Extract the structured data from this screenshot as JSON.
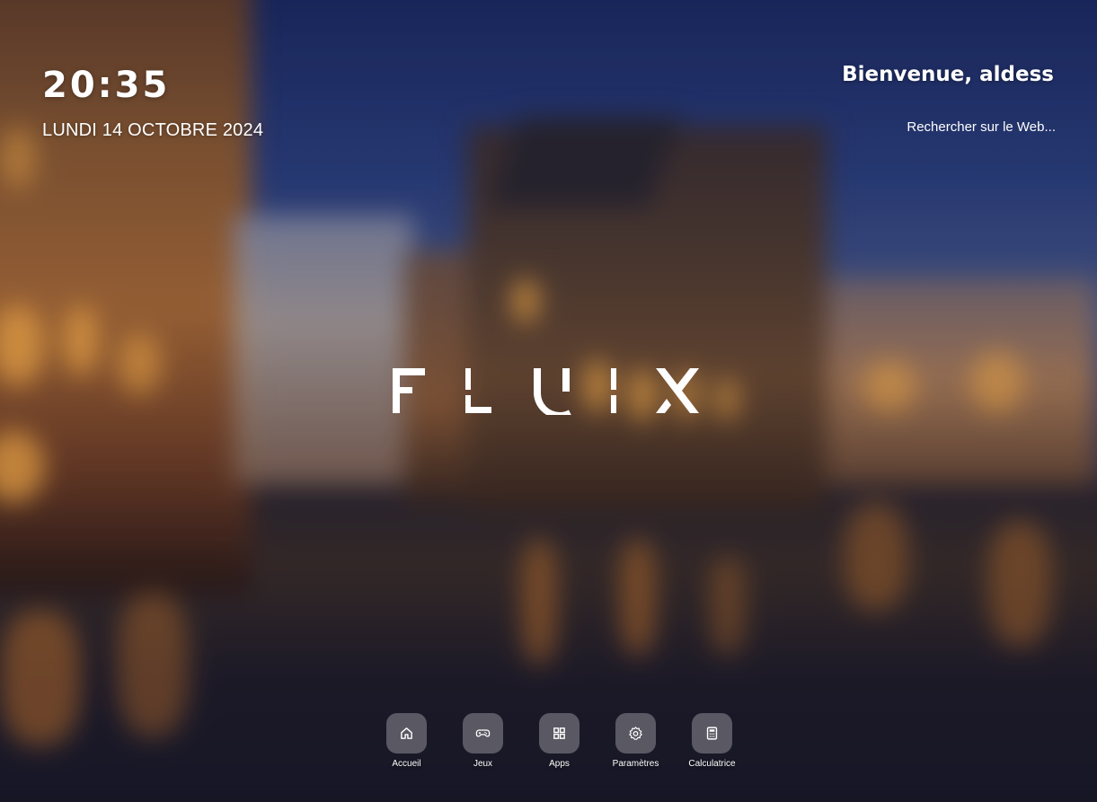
{
  "clock": {
    "time": "20:35",
    "date": "LUNDI 14 OCTOBRE 2024"
  },
  "header": {
    "welcome": "Bienvenue, aldess"
  },
  "search": {
    "placeholder": "Rechercher sur le Web..."
  },
  "logo": {
    "text": "FLUIX"
  },
  "dock": {
    "items": [
      {
        "label": "Accueil",
        "icon": "home-icon"
      },
      {
        "label": "Jeux",
        "icon": "gamepad-icon"
      },
      {
        "label": "Apps",
        "icon": "apps-grid-icon"
      },
      {
        "label": "Paramètres",
        "icon": "gear-icon"
      },
      {
        "label": "Calculatrice",
        "icon": "calculator-icon"
      }
    ]
  },
  "colors": {
    "text": "#ffffff",
    "dock_button_bg": "rgba(255,255,255,0.28)"
  }
}
